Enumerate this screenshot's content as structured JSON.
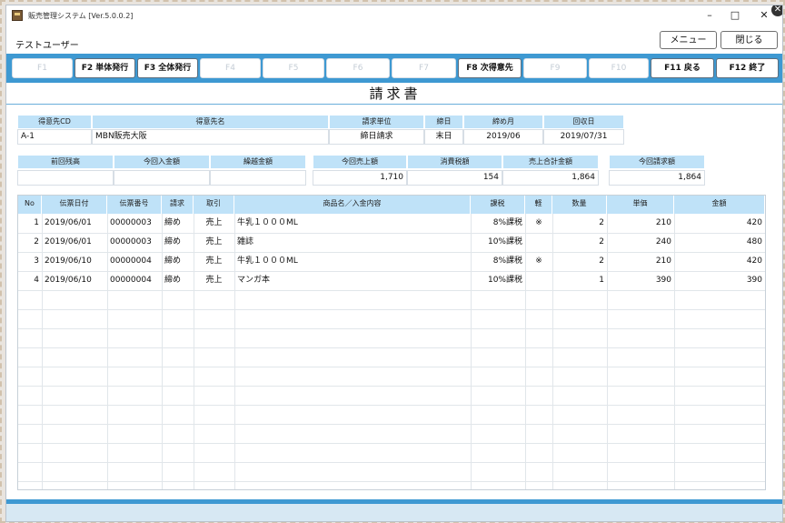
{
  "window": {
    "title": "販売管理システム [Ver.5.0.0.2]",
    "minimize": "–",
    "maximize": "□",
    "close": "✕"
  },
  "user": "テストユーザー",
  "top_buttons": {
    "menu": "メニュー",
    "close": "閉じる"
  },
  "fkeys": [
    {
      "label": "F1",
      "enabled": false
    },
    {
      "label": "F2 単体発行",
      "enabled": true
    },
    {
      "label": "F3 全体発行",
      "enabled": true
    },
    {
      "label": "F4",
      "enabled": false
    },
    {
      "label": "F5",
      "enabled": false
    },
    {
      "label": "F6",
      "enabled": false
    },
    {
      "label": "F7",
      "enabled": false
    },
    {
      "label": "F8 次得意先",
      "enabled": true
    },
    {
      "label": "F9",
      "enabled": false
    },
    {
      "label": "F10",
      "enabled": false
    },
    {
      "label": "F11 戻る",
      "enabled": true
    },
    {
      "label": "F12 終了",
      "enabled": true
    }
  ],
  "doc_title": "請求書",
  "info": {
    "headers": [
      "得意先CD",
      "得意先名",
      "請求単位",
      "締日",
      "締め月",
      "回収日"
    ],
    "values": [
      "A-1",
      "MBN販売大阪",
      "締日請求",
      "末日",
      "2019/06",
      "2019/07/31"
    ]
  },
  "summary1": {
    "headers": [
      "前回残高",
      "今回入金額",
      "繰越金額"
    ],
    "values": [
      "",
      "",
      ""
    ]
  },
  "summary2": {
    "headers": [
      "今回売上額",
      "消費税額",
      "売上合計金額"
    ],
    "values": [
      "1,710",
      "154",
      "1,864"
    ]
  },
  "summary3": {
    "headers": [
      "今回請求額"
    ],
    "values": [
      "1,864"
    ]
  },
  "table": {
    "headers": [
      "No",
      "伝票日付",
      "伝票番号",
      "請求",
      "取引",
      "商品名／入金内容",
      "課税",
      "軽",
      "数量",
      "単価",
      "金額"
    ],
    "rows": [
      [
        "1",
        "2019/06/01",
        "00000003",
        "締め",
        "売上",
        "牛乳１０００ML",
        "8%課税",
        "※",
        "2",
        "210",
        "420"
      ],
      [
        "2",
        "2019/06/01",
        "00000003",
        "締め",
        "売上",
        "雑誌",
        "10%課税",
        "",
        "2",
        "240",
        "480"
      ],
      [
        "3",
        "2019/06/10",
        "00000004",
        "締め",
        "売上",
        "牛乳１０００ML",
        "8%課税",
        "※",
        "2",
        "210",
        "420"
      ],
      [
        "4",
        "2019/06/10",
        "00000004",
        "締め",
        "売上",
        "マンガ本",
        "10%課税",
        "",
        "1",
        "390",
        "390"
      ]
    ]
  }
}
